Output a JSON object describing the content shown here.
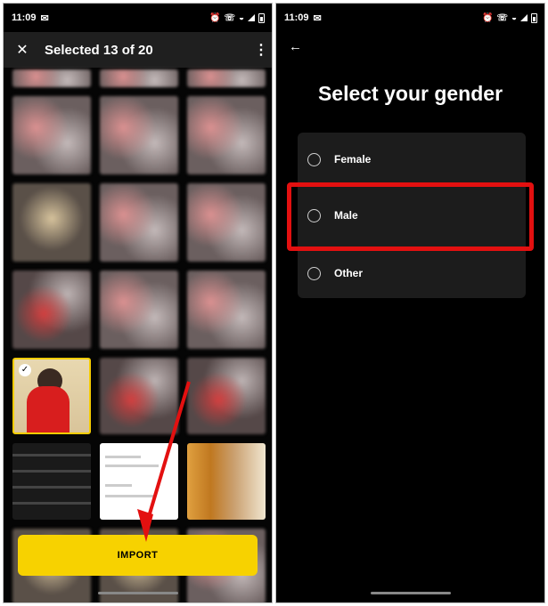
{
  "left_screen": {
    "status": {
      "time": "11:09"
    },
    "header": {
      "title": "Selected 13 of 20",
      "close_icon": "close-icon",
      "more_icon": "more-vert-icon"
    },
    "import_label": "IMPORT"
  },
  "right_screen": {
    "status": {
      "time": "11:09"
    },
    "back_icon": "arrow-left-icon",
    "title": "Select your gender",
    "options": [
      {
        "label": "Female",
        "selected": false
      },
      {
        "label": "Male",
        "selected": false,
        "highlighted": true
      },
      {
        "label": "Other",
        "selected": false
      }
    ]
  },
  "colors": {
    "accent": "#f7d200",
    "highlight": "#e31010",
    "background": "#000000"
  }
}
